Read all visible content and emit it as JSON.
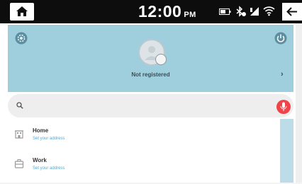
{
  "status_bar": {
    "time": "12:00",
    "am_pm": "PM",
    "icons": [
      "home-icon",
      "battery-icon",
      "bluetooth-icon",
      "cellular-signal-icon",
      "wifi-icon",
      "back-arrow-icon"
    ]
  },
  "profile": {
    "status": "Not registered",
    "icons": [
      "settings-gear-icon",
      "power-icon",
      "avatar-icon",
      "chevron-right-icon"
    ]
  },
  "search": {
    "placeholder": "",
    "value": "",
    "icons": [
      "search-icon",
      "microphone-icon"
    ]
  },
  "list": {
    "items": [
      {
        "title": "Home",
        "subtitle": "Set your address",
        "icon": "home-building-icon"
      },
      {
        "title": "Work",
        "subtitle": "Set your address",
        "icon": "work-building-icon"
      }
    ]
  },
  "colors": {
    "header_bg": "#9fcfdd",
    "status_bar_bg": "#0d0d0d",
    "mic_button": "#f0434a",
    "subtitle_text": "#5aa7c8"
  },
  "chevron": "›"
}
